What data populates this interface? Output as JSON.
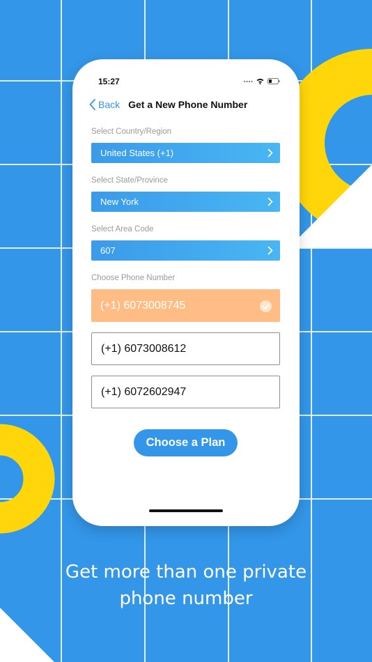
{
  "colors": {
    "background": "#3396E8",
    "accent_yellow": "#FFD60A",
    "selected_orange": "#FFBD85",
    "grid_line": "#E8F3FC"
  },
  "status_bar": {
    "time": "15:27",
    "icons": [
      "signal-dots-icon",
      "wifi-icon",
      "battery-icon"
    ]
  },
  "nav": {
    "back_label": "Back",
    "title": "Get a New Phone Number"
  },
  "form": {
    "country_label": "Select Country/Region",
    "country_value": "United States (+1)",
    "state_label": "Select State/Province",
    "state_value": "New York",
    "area_label": "Select Area Code",
    "area_value": "607",
    "numbers_label": "Choose Phone Number",
    "numbers": [
      {
        "value": "(+1) 6073008745",
        "selected": true
      },
      {
        "value": "(+1) 6073008612",
        "selected": false
      },
      {
        "value": "(+1) 6072602947",
        "selected": false
      }
    ],
    "cta_label": "Choose a Plan"
  },
  "tagline": {
    "line1": "Get more than one private",
    "line2": "phone number"
  }
}
